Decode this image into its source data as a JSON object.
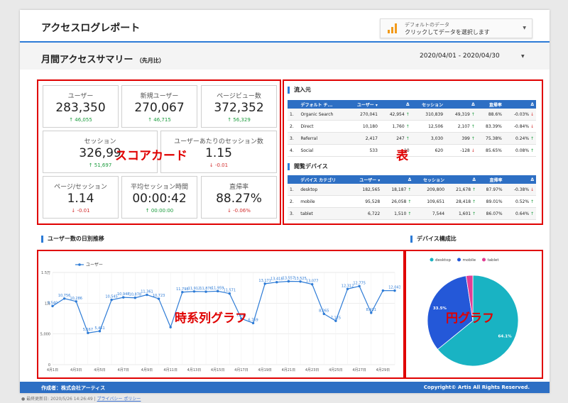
{
  "header": {
    "title": "アクセスログレポート",
    "data_selector": {
      "small": "デフォルトのデータ",
      "main": "クリックしてデータを選択します"
    }
  },
  "subheader": {
    "title": "月間アクセスサマリー",
    "note": "（先月比）",
    "date_range": "2020/04/01 - 2020/04/30"
  },
  "scorecards": [
    {
      "label": "ユーザー",
      "value": "283,350",
      "delta": "46,055",
      "dir": "up"
    },
    {
      "label": "新規ユーザー",
      "value": "270,067",
      "delta": "46,715",
      "dir": "up"
    },
    {
      "label": "ページビュー数",
      "value": "372,352",
      "delta": "56,329",
      "dir": "up"
    },
    {
      "label": "セッション",
      "value": "326,99",
      "delta": "51,697",
      "dir": "up"
    },
    {
      "label": "ユーザーあたりのセッション数",
      "value": "1.15",
      "delta": "-0.01",
      "dir": "down"
    },
    {
      "label": "ページ/セッション",
      "value": "1.14",
      "delta": "-0.01",
      "dir": "down"
    },
    {
      "label": "平均セッション時間",
      "value": "00:00:42",
      "delta": "00:00:00",
      "dir": "up"
    },
    {
      "label": "直帰率",
      "value": "88.27%",
      "delta": "-0.06%",
      "dir": "down"
    }
  ],
  "annotations": {
    "scorecard": "スコアカード",
    "table": "表",
    "timeseries": "時系列グラフ",
    "pie": "円グラフ"
  },
  "sources": {
    "title": "流入元",
    "columns": [
      "デフォルト チ...",
      "ユーザー ▾",
      "Δ",
      "セッション",
      "Δ",
      "直帰率",
      "Δ"
    ],
    "rows": [
      [
        "1.",
        "Organic Search",
        "270,041",
        "42,954 ↑",
        "310,839",
        "49,319 ↑",
        "88.6%",
        "-0.03% ↓"
      ],
      [
        "2.",
        "Direct",
        "10,180",
        "1,760 ↑",
        "12,506",
        "2,107 ↑",
        "83.39%",
        "-0.84% ↓"
      ],
      [
        "3.",
        "Referral",
        "2,417",
        "247 ↑",
        "3,030",
        "399 ↑",
        "75.38%",
        "0.24% ↑"
      ],
      [
        "4.",
        "Social",
        "533",
        "-10",
        "620",
        "-128 ↓",
        "85.65%",
        "0.08% ↑"
      ]
    ]
  },
  "devices": {
    "title": "閲覧デバイス",
    "columns": [
      "デバイス カテゴリ",
      "ユーザー ▾",
      "Δ",
      "セッション",
      "Δ",
      "直帰率",
      "Δ"
    ],
    "rows": [
      [
        "1.",
        "desktop",
        "182,565",
        "18,187 ↑",
        "209,800",
        "21,678 ↑",
        "87.97%",
        "-0.38% ↓"
      ],
      [
        "2.",
        "mobile",
        "95,528",
        "26,058 ↑",
        "109,651",
        "28,418 ↑",
        "89.01%",
        "0.52% ↑"
      ],
      [
        "3.",
        "tablet",
        "6,722",
        "1,510 ↑",
        "7,544",
        "1,601 ↑",
        "86.07%",
        "0.64% ↑"
      ]
    ]
  },
  "timeseries_title": "ユーザー数の日別推移",
  "pie_title": "デバイス構成比",
  "chart_data": [
    {
      "type": "line",
      "x": [
        "4月1日",
        "4月2日",
        "4月3日",
        "4月4日",
        "4月5日",
        "4月6日",
        "4月7日",
        "4月8日",
        "4月9日",
        "4月10日",
        "4月11日",
        "4月12日",
        "4月13日",
        "4月14日",
        "4月15日",
        "4月16日",
        "4月17日",
        "4月18日",
        "4月19日",
        "4月20日",
        "4月21日",
        "4月22日",
        "4月23日",
        "4月24日",
        "4月25日",
        "4月26日",
        "4月27日",
        "4月28日",
        "4月29日",
        "4月30日"
      ],
      "xticks": [
        "4月1日",
        "4月3日",
        "4月5日",
        "4月7日",
        "4月9日",
        "4月11日",
        "4月13日",
        "4月15日",
        "4月17日",
        "4月19日",
        "4月21日",
        "4月23日",
        "4月25日",
        "4月27日",
        "4月29日"
      ],
      "series": [
        {
          "name": "ユーザー",
          "values": [
            9540,
            10756,
            10286,
            5167,
            5451,
            10545,
            10948,
            10878,
            11361,
            10723,
            6100,
            11798,
            11912,
            11876,
            11959,
            11571,
            7491,
            6769,
            13171,
            13418,
            13557,
            13525,
            13077,
            8265,
            7125,
            12312,
            12775,
            8431,
            12043,
            12043
          ]
        }
      ],
      "data_labels": [
        "9,540",
        "10,756",
        "10,286",
        "5,167",
        "5,451",
        "10,545",
        "10,948",
        "10,878",
        "11,361",
        "10,723",
        "",
        "11,798",
        "11,912",
        "11,876",
        "11,959",
        "11,571",
        "7,491",
        "6,769",
        "13,171",
        "13,418",
        "13,557",
        "13,525",
        "13,077",
        "8,265",
        "7,125",
        "12,312",
        "12,775",
        "8,431",
        "",
        "12,043"
      ],
      "yticks": [
        "1.5万",
        "1万",
        "5,000",
        "0"
      ],
      "ylim": [
        0,
        15000
      ],
      "legend": "top-left",
      "color": "#2d7bd6",
      "grid": true
    },
    {
      "type": "pie",
      "labels": [
        "desktop",
        "mobile",
        "tablet"
      ],
      "values": [
        64.1,
        33.5,
        2.4
      ],
      "slice_labels": [
        "64.1%",
        "33.5%",
        ""
      ],
      "colors": [
        "#19b3c3",
        "#2458d8",
        "#e23d95"
      ],
      "legend": "top"
    }
  ],
  "footer": {
    "left": "作成者：株式会社アーティス",
    "right": "Copyright© Artis All Rights Reserved."
  },
  "below": {
    "updated": "● 最終更新日: 2020/5/26 14:26:49",
    "sep": " | ",
    "privacy": "プライバシー ポリシー"
  }
}
